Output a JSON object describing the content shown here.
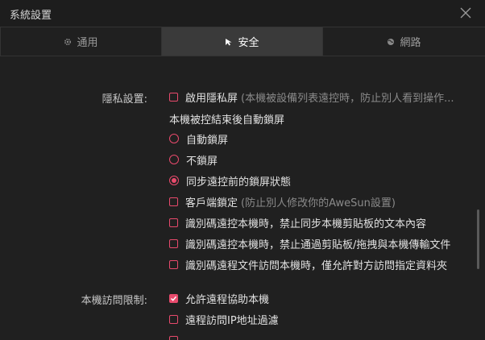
{
  "window": {
    "title": "系統設置"
  },
  "tabs": [
    {
      "label": "通用",
      "icon": "gear-icon"
    },
    {
      "label": "安全",
      "icon": "cursor-icon"
    },
    {
      "label": "網路",
      "icon": "globe-icon"
    }
  ],
  "colors": {
    "accent": "#e84a6c",
    "active_tab": "#3a3a3a",
    "background": "#202020"
  },
  "privacy": {
    "label": "隱私設置:",
    "privacy_screen": {
      "label": "啟用隱私屏",
      "hint": "(本機被設備列表遠控時，防止別人看到操作...",
      "checked": false
    },
    "auto_lock_title": "本機被控結束後自動鎖屏",
    "lock_options": [
      {
        "label": "自動鎖屏",
        "selected": false
      },
      {
        "label": "不鎖屏",
        "selected": false
      },
      {
        "label": "同步遠控前的鎖屏狀態",
        "selected": true
      }
    ],
    "client_lock": {
      "label": "客戶端鎖定",
      "hint": "(防止別人修改你的AweSun設置)",
      "checked": false
    },
    "options": [
      {
        "label": "識別碼遠控本機時，禁止同步本機剪貼板的文本內容",
        "checked": false
      },
      {
        "label": "識別碼遠控本機時，禁止通過剪貼板/拖拽與本機傳輸文件",
        "checked": false
      },
      {
        "label": "識別碼遠程文件訪問本機時，僅允許對方訪問指定資料夾",
        "checked": false
      }
    ]
  },
  "access": {
    "label": "本機訪問限制:",
    "options": [
      {
        "label": "允許遠程協助本機",
        "checked": true
      },
      {
        "label": "遠程訪問IP地址過濾",
        "checked": false
      }
    ]
  }
}
